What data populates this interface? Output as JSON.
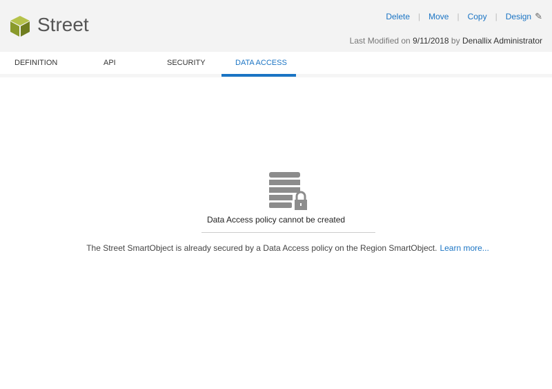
{
  "header": {
    "title": "Street",
    "actions": [
      "Delete",
      "Move",
      "Copy",
      "Design"
    ],
    "modified_label": "Last Modified on",
    "modified_date": "9/11/2018",
    "by_label": "by",
    "modified_by": "Denallix Administrator"
  },
  "tabs": [
    "DEFINITION",
    "API",
    "SECURITY",
    "DATA ACCESS"
  ],
  "active_tab": "DATA ACCESS",
  "empty_state": {
    "heading": "Data Access policy cannot be created",
    "description": "The Street SmartObject is already secured by a Data Access policy on the Region SmartObject.",
    "link": "Learn more..."
  },
  "colors": {
    "accent": "#1a74c4",
    "logo": "#8a9a2b"
  }
}
